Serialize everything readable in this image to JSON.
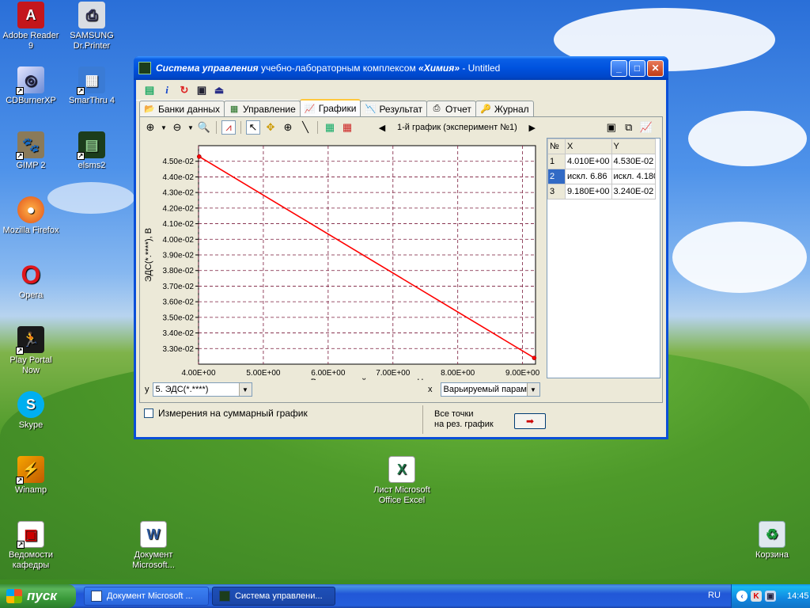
{
  "desktop": {
    "icons": [
      {
        "label": "Adobe Reader 9"
      },
      {
        "label": "SAMSUNG Dr.Printer"
      },
      {
        "label": "CDBurnerXP"
      },
      {
        "label": "SmarThru 4"
      },
      {
        "label": "GIMP 2"
      },
      {
        "label": "elsms2"
      },
      {
        "label": "Mozilla Firefox"
      },
      {
        "label": "Opera"
      },
      {
        "label": "Play Portal Now"
      },
      {
        "label": "Skype"
      },
      {
        "label": "Winamp"
      },
      {
        "label": "Ведомости кафедры"
      },
      {
        "label": "Документ Microsoft..."
      },
      {
        "label": "Лист Microsoft Office Excel"
      },
      {
        "label": "Корзина"
      }
    ]
  },
  "window": {
    "title_prefix": "Система управления",
    "title_middle": " учебно-лабораторным комплексом ",
    "title_bold": "«Химия»",
    "title_suffix": " - Untitled",
    "tabs": [
      {
        "label": "Банки данных",
        "icon": "folder-open-icon"
      },
      {
        "label": "Управление",
        "icon": "control-panel-icon"
      },
      {
        "label": "Графики",
        "icon": "chart-icon"
      },
      {
        "label": "Результат",
        "icon": "result-chart-icon"
      },
      {
        "label": "Отчет",
        "icon": "printer-icon"
      },
      {
        "label": "Журнал",
        "icon": "key-icon"
      }
    ],
    "active_tab": "Графики",
    "graph_nav_label": "1-й график (эксперимент №1)",
    "y_selector_label": "y",
    "y_selector_value": "5. ЭДС(*.****)",
    "x_selector_label": "x",
    "x_selector_value": "Варьируемый парам",
    "summary_checkbox_label": "Измерения на суммарный график",
    "all_points_line1": "Все точки",
    "all_points_line2": "на рез. график",
    "table": {
      "headers": [
        "№",
        "X",
        "Y"
      ],
      "rows": [
        {
          "n": "1",
          "x": "4.010E+00",
          "y": "4.530E-02"
        },
        {
          "n": "2",
          "x": "искл. 6.86",
          "y": "искл. 4.180"
        },
        {
          "n": "3",
          "x": "9.180E+00",
          "y": "3.240E-02"
        }
      ]
    }
  },
  "chart_data": {
    "type": "line",
    "xlabel": "Варьируемый параметр, pH",
    "ylabel": "ЭДС(*.****), В",
    "xlim": [
      4.0,
      9.2
    ],
    "ylim": [
      0.032,
      0.046
    ],
    "x_ticks": [
      "4.00E+00",
      "5.00E+00",
      "6.00E+00",
      "7.00E+00",
      "8.00E+00",
      "9.00E+00"
    ],
    "y_ticks": [
      "4.50e-02",
      "4.40e-02",
      "4.30e-02",
      "4.20e-02",
      "4.10e-02",
      "4.00e-02",
      "3.90e-02",
      "3.80e-02",
      "3.70e-02",
      "3.60e-02",
      "3.50e-02",
      "3.40e-02",
      "3.30e-02"
    ],
    "series": [
      {
        "x": [
          4.01,
          9.18
        ],
        "y": [
          0.0453,
          0.0324
        ],
        "color": "#ff0000"
      }
    ],
    "grid": true
  },
  "taskbar": {
    "start_label": "пуск",
    "tasks": [
      {
        "label": "Документ Microsoft ..."
      },
      {
        "label": "Система управлени..."
      }
    ],
    "lang": "RU",
    "clock": "14:45"
  }
}
